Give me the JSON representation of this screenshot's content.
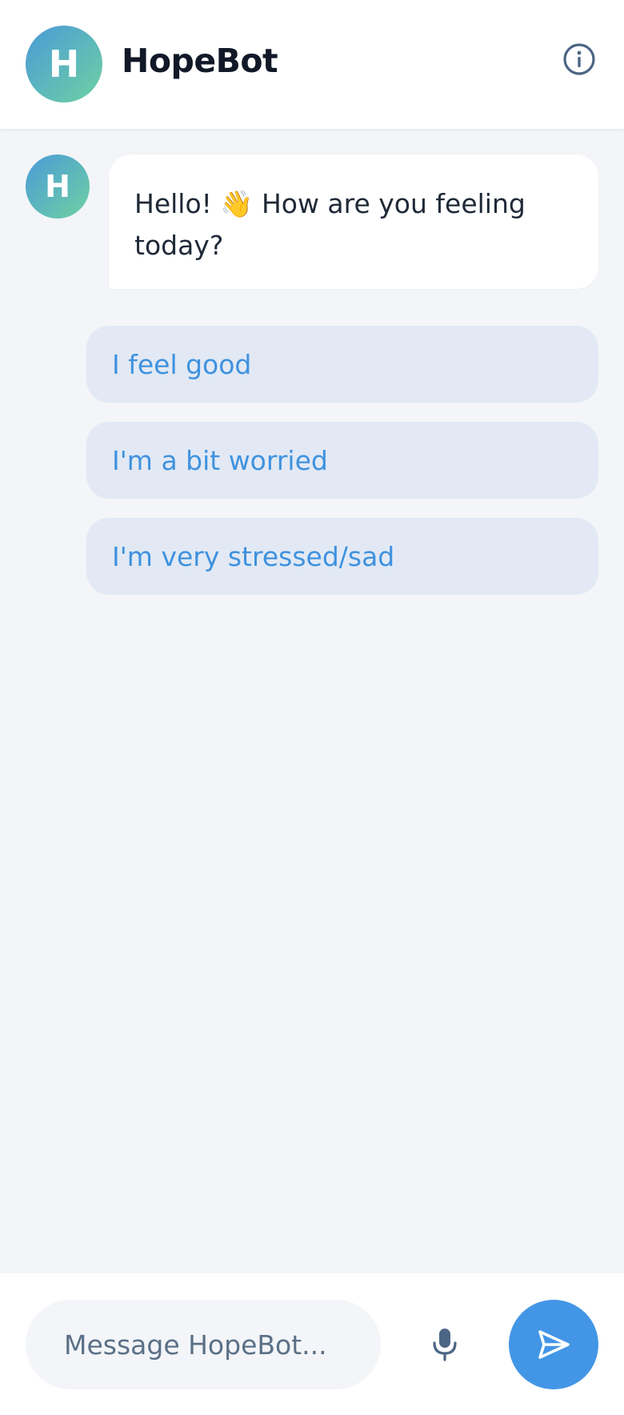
{
  "header": {
    "avatar_letter": "H",
    "title": "HopeBot",
    "info_icon": "info-icon"
  },
  "chat": {
    "bot_avatar_letter": "H",
    "bot_message_line1": "Hello! 👋 How are you feeling",
    "bot_message_line2": "today?",
    "quick_replies": [
      {
        "label": "I feel good"
      },
      {
        "label": "I'm a bit worried"
      },
      {
        "label": "I'm very stressed/sad"
      }
    ]
  },
  "footer": {
    "input_placeholder": "Message HopeBot...",
    "input_value": "",
    "mic_icon": "microphone-icon",
    "send_icon": "send-icon"
  },
  "colors": {
    "accent": "#4396e6",
    "avatar_gradient_start": "#4a9bd8",
    "avatar_gradient_end": "#6fd1a2",
    "reply_background": "#e2e9f4",
    "reply_text": "#3f92df",
    "chat_background": "#f3f5f8",
    "icon_color": "#4b6584"
  }
}
